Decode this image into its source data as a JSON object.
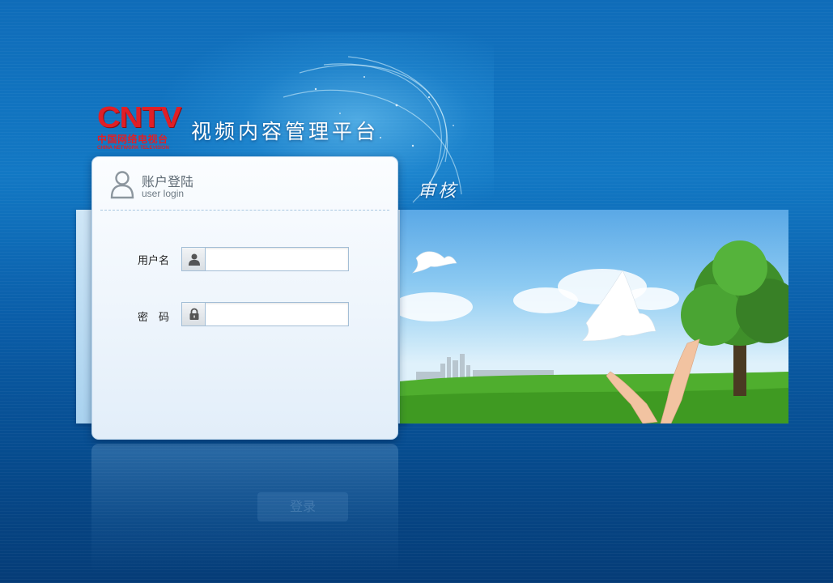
{
  "brand": {
    "logo_mark": "CNTV",
    "logo_cn": "中国网络电视台",
    "logo_en": "CHINA NETWORK TELEVISION",
    "platform_title": "视频内容管理平台",
    "section_label": "审核"
  },
  "login": {
    "title": "账户登陆",
    "subtitle": "user login",
    "username_label": "用户名",
    "username_value": "",
    "password_label": "密　码",
    "password_value": "",
    "submit_ghost_label": "登录"
  },
  "colors": {
    "background": "#0f6cb9",
    "logo_red": "#e01f26",
    "card_bg": "#f4f9fe",
    "field_border": "#a3bed6"
  },
  "icons": [
    "user-silhouette-icon",
    "user-icon",
    "lock-icon",
    "dove-icon",
    "tree-icon",
    "hands-icon",
    "city-skyline-icon"
  ]
}
